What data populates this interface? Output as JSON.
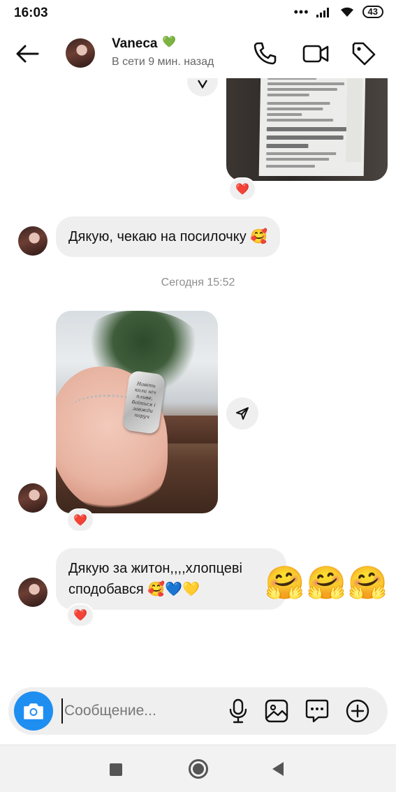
{
  "status_bar": {
    "time": "16:03",
    "dots": "•••",
    "battery": "43",
    "icons": [
      "signal-icon",
      "wifi-icon",
      "battery-icon"
    ]
  },
  "header": {
    "contact_name": "Vaneca",
    "name_emoji": "💚",
    "presence": "В сети 9 мин. назад",
    "icons": [
      "back-arrow-icon",
      "phone-icon",
      "video-camera-icon",
      "tag-icon"
    ]
  },
  "conversation": {
    "receipt_photo": {
      "reaction": "❤️",
      "receipt_text": [
        "ФІЗИЧНА ОСОБА",
        "УСІК ІВАННА МИКОЛАЇВНА",
        "С.ІЛЬНИК, ВІДДІЛЕННЯ №1, КИЇВСЬКА",
        "ОБЛ.",
        "0937353219",
        "ТИП ВІДПРАВЛЕННЯ: ПОСИЛКА",
        "ВАГА: 1 КГ (ФАКТИЧНА)",
        "МІСЦЬ: 1",
        "ОПИС: ЖИТОН",
        "ОГОЛОШЕНА ВАРТІСТЬ: 320 ГРН",
        "ЗВОРОТНА ДОСТАВКА:",
        "Грошовий переказ",
        "320 ГРН",
        "ПЛАТНИК ЗВОРОТНОЇ ДОСТАВКИ: Усік",
        "Іванна Миколаївна, Ільник",
        "ДОСТАВКА СПЛАЧЕНО",
        "ОТРИМУВАЧ: 100 ГРН",
        "СУПУТНІМ ВІДПОВІДЬ РОЗРАХУНОК",
        "Оверцтний 100% ТРН 100 ГРН"
      ]
    },
    "message_1": "Дякую, чекаю на посилочку 🥰",
    "date_divider": "Сегодня 15:52",
    "photo_main": {
      "tag_engraving": "Навіть коли ніч пливе, боїться і завжди поруч",
      "reaction": "❤️"
    },
    "message_2": "Дякую за житон,,,,хлопцеві сподобався 🥰💙💛",
    "message_2_reaction": "❤️",
    "outgoing_emojis": [
      "🤗",
      "🤗",
      "🤗"
    ]
  },
  "composer": {
    "placeholder": "Сообщение...",
    "icons": [
      "camera-icon",
      "microphone-icon",
      "gallery-icon",
      "sticker-icon",
      "plus-circle-icon"
    ],
    "camera_color": "#1f8ef1"
  },
  "nav_bar": {
    "icons": [
      "recents-square-icon",
      "home-circle-icon",
      "back-triangle-icon"
    ]
  }
}
